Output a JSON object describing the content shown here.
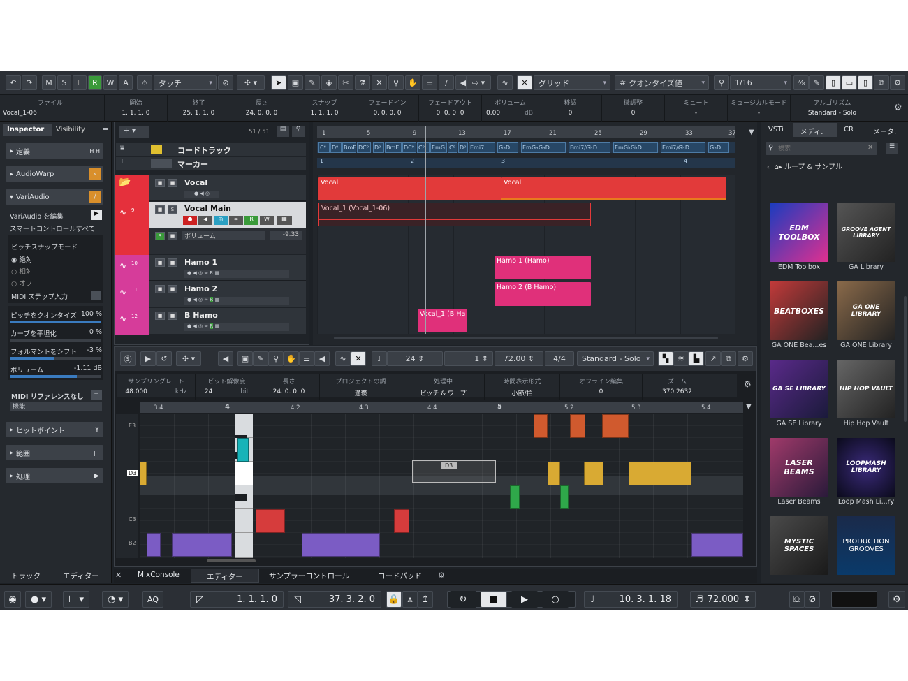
{
  "toolbar": {
    "modes": [
      "M",
      "S",
      "L",
      "R",
      "W",
      "A"
    ],
    "automation_mode": "タッチ",
    "snap_type": "グリッド",
    "quantize_label": "クオンタイズ値",
    "quantize_value": "1/16"
  },
  "info_line": {
    "track_name": "Vocal_1-06",
    "fields": [
      {
        "label": "ファイル",
        "value": ""
      },
      {
        "label": "開始",
        "value": "1. 1. 1.  0"
      },
      {
        "label": "終了",
        "value": "25. 1. 1.  0"
      },
      {
        "label": "長さ",
        "value": "24. 0. 0.  0"
      },
      {
        "label": "スナップ",
        "value": "1. 1. 1.  0"
      },
      {
        "label": "フェードイン",
        "value": "0. 0. 0.  0"
      },
      {
        "label": "フェードアウト",
        "value": "0. 0. 0.  0"
      },
      {
        "label": "ボリューム",
        "value": "0.00"
      },
      {
        "label": "移調",
        "value": "0"
      },
      {
        "label": "微調整",
        "value": "0"
      },
      {
        "label": "ミュート",
        "value": "-"
      },
      {
        "label": "ミュージカルモード",
        "value": "-"
      },
      {
        "label": "アルゴリズム",
        "value": "Standard - Solo"
      }
    ],
    "volume_unit": "dB"
  },
  "inspector": {
    "tabs": [
      "Inspector",
      "Visibility"
    ],
    "sections": [
      "定義",
      "AudioWarp",
      "VariAudio"
    ],
    "variaudio_edit": "VariAudio を編集",
    "smart_controls": "スマートコントロールすべて",
    "pitch_snap_mode": "ピッチスナップモード",
    "snap_options": [
      "絶対",
      "相対",
      "オフ"
    ],
    "midi_step": "MIDI ステップ入力",
    "params": [
      {
        "label": "ピッチをクオンタイズ",
        "value": "100 %"
      },
      {
        "label": "カーブを平坦化",
        "value": "0 %"
      },
      {
        "label": "フォルマントをシフト",
        "value": "-3 %"
      },
      {
        "label": "ボリューム",
        "value": "-1.11 dB"
      }
    ],
    "midi_ref": "MIDI リファレンスなし",
    "midi_ref_mode": "機能",
    "bottom_sections": [
      "ヒットポイント",
      "範囲",
      "処理"
    ]
  },
  "left_bottom_tabs": [
    "トラック",
    "エディター"
  ],
  "track_list": {
    "count": "51 / 51",
    "chord_track": "コードトラック",
    "marker_track": "マーカー",
    "tracks": [
      {
        "name": "Vocal",
        "num": ""
      },
      {
        "name": "Vocal Main",
        "num": "9"
      },
      {
        "name": "Hamo 1",
        "num": "10"
      },
      {
        "name": "Hamo 2",
        "num": "11"
      },
      {
        "name": "B Hamo",
        "num": "12"
      }
    ],
    "volume_label": "ボリューム",
    "volume_value": "-9.33"
  },
  "ruler_bars": [
    "1",
    "5",
    "9",
    "13",
    "17",
    "21",
    "25",
    "29",
    "33",
    "37"
  ],
  "chords": [
    "C⁶",
    "D⁹",
    "BmE",
    "DC⁹",
    "D⁹",
    "BmE",
    "DC⁹",
    "C⁹",
    "EmG",
    "C⁹",
    "D⁹",
    "Emi7",
    "G♭D",
    "EmG♭G♭D",
    "Emi7/G♭D",
    "EmG♭G♭D",
    "Emi7/G♭D",
    "G♭D"
  ],
  "markers": [
    "1",
    "2",
    "3",
    "4"
  ],
  "events": {
    "vocal_folder_1": "Vocal",
    "vocal_folder_2": "Vocal",
    "vocal_main": "Vocal_1 (Vocal_1-06)",
    "hamo1": "Hamo 1 (Hamo)",
    "hamo2": "Hamo 2 (B Hamo)",
    "bhamo": "Vocal_1 (B Ha"
  },
  "editor": {
    "values": [
      "24",
      "1",
      "72.00",
      "4/4"
    ],
    "algorithm": "Standard - Solo",
    "info_fields": [
      {
        "label": "サンプリングレート",
        "value": "48.000",
        "unit": "kHz"
      },
      {
        "label": "ビット解像度",
        "value": "24",
        "unit": "bit"
      },
      {
        "label": "長さ",
        "value": "24. 0. 0. 0",
        "unit": ""
      },
      {
        "label": "プロジェクトの調",
        "value": "適褒",
        "unit": ""
      },
      {
        "label": "処理中",
        "value": "ピッチ & ワープ",
        "unit": ""
      },
      {
        "label": "時間表示形式",
        "value": "小節/拍",
        "unit": ""
      },
      {
        "label": "オフライン編集",
        "value": "0",
        "unit": ""
      },
      {
        "label": "ズーム",
        "value": "370.2632",
        "unit": ""
      }
    ],
    "ruler": [
      "3.4",
      "4",
      "4.2",
      "4.3",
      "4.4",
      "5",
      "5.2",
      "5.3",
      "5.4"
    ],
    "keys": [
      "E3",
      "D3",
      "C3",
      "B2"
    ],
    "selected_note": "D3"
  },
  "lower_tabs": [
    "MixConsole",
    "エディター",
    "サンプラーコントロール",
    "コードパッド"
  ],
  "mediabay": {
    "tabs": [
      "VSTi",
      "メディ.",
      "CR",
      "メータ."
    ],
    "search_placeholder": "検索",
    "breadcrumb": "ループ & サンプル",
    "items": [
      {
        "label": "EDM Toolbox",
        "art": "EDM TOOLBOX"
      },
      {
        "label": "GA Library",
        "art": "GROOVE AGENT LIBRARY"
      },
      {
        "label": "GA ONE Bea...es",
        "art": "BEATBOXES"
      },
      {
        "label": "GA ONE Library",
        "art": "GA ONE LIBRARY"
      },
      {
        "label": "GA SE Library",
        "art": "GA SE LIBRARY"
      },
      {
        "label": "Hip Hop Vault",
        "art": "HIP HOP VAULT"
      },
      {
        "label": "Laser Beams",
        "art": "LASER BEAMS"
      },
      {
        "label": "Loop Mash Li...ry",
        "art": "LOOPMASH LIBRARY"
      },
      {
        "label": "",
        "art": "MYSTIC SPACES"
      },
      {
        "label": "",
        "art": "PRODUCTION GROOVES"
      }
    ]
  },
  "transport": {
    "left_locator": "1. 1. 1.   0",
    "right_locator": "37. 3. 2.   0",
    "position": "10. 3. 1. 18",
    "tempo": "72.000"
  },
  "colors": {
    "accent": "#3a7bbf",
    "record": "#d63a3a",
    "hamo": "#e0307a",
    "vocal": "#e23a3a"
  }
}
